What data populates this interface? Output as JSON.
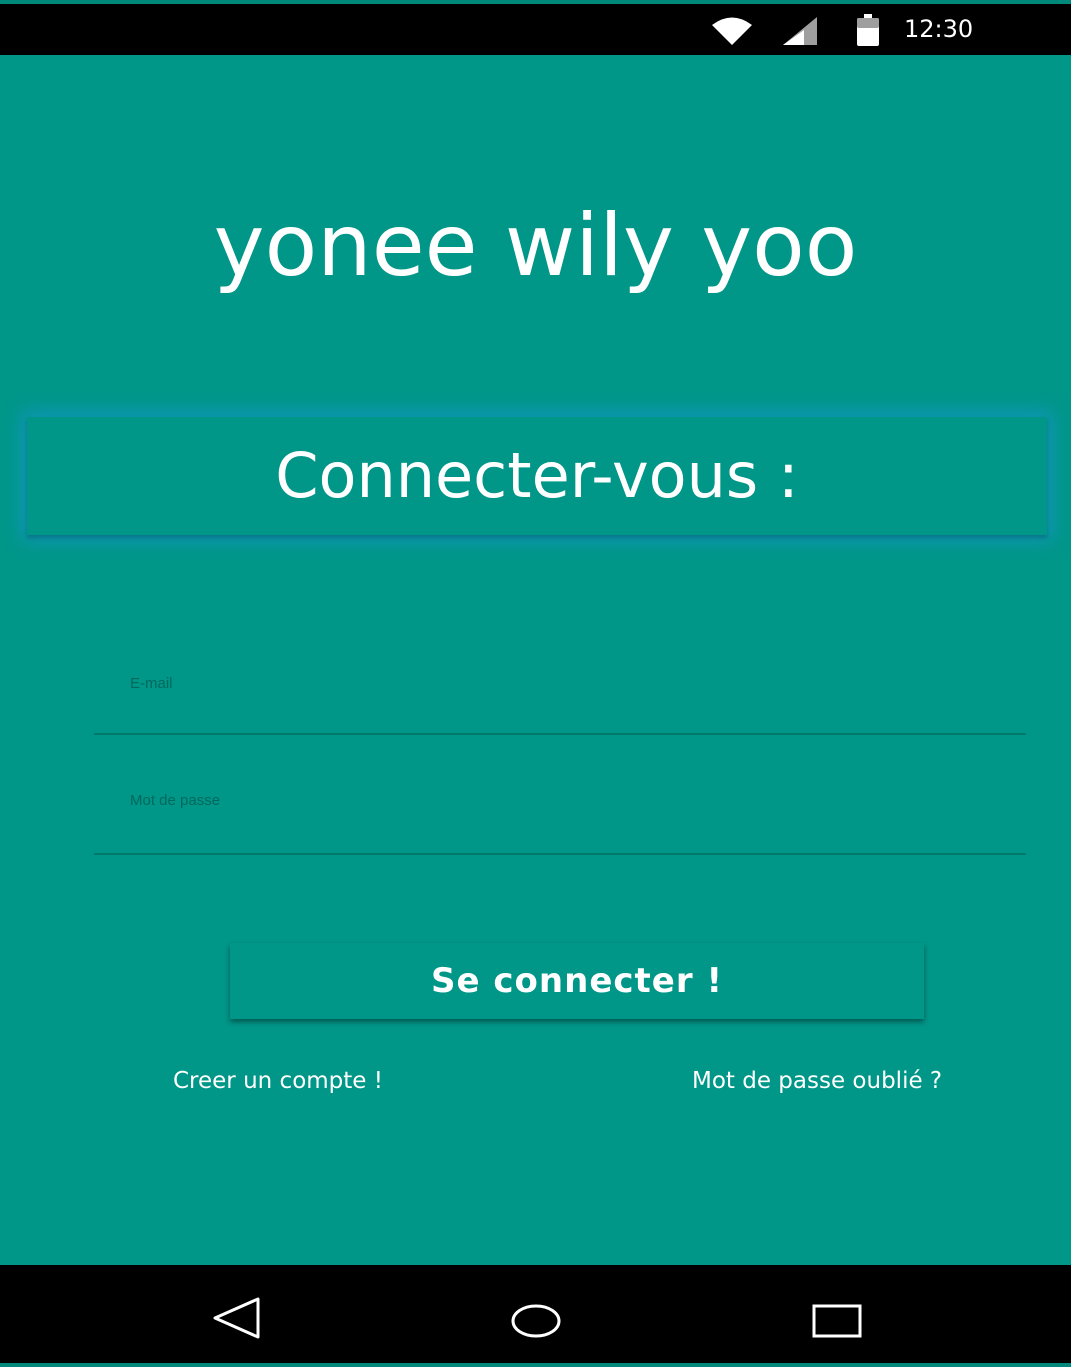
{
  "status_bar": {
    "time": "12:30",
    "icons": [
      "wifi-icon",
      "signal-icon",
      "battery-icon"
    ]
  },
  "app": {
    "title": "yonee wily yoo"
  },
  "login": {
    "header": "Connecter-vous :",
    "email_placeholder": "E-mail",
    "password_placeholder": "Mot de passe",
    "submit_label": "Se connecter !",
    "create_account_label": "Creer un compte !",
    "forgot_password_label": "Mot de passe oublié ?"
  },
  "nav_bar": {
    "buttons": [
      "back-icon",
      "home-icon",
      "recent-apps-icon"
    ]
  },
  "colors": {
    "background": "#009688",
    "system_bars": "#000000",
    "text": "#ffffff",
    "header_glow": "#2196f3"
  }
}
